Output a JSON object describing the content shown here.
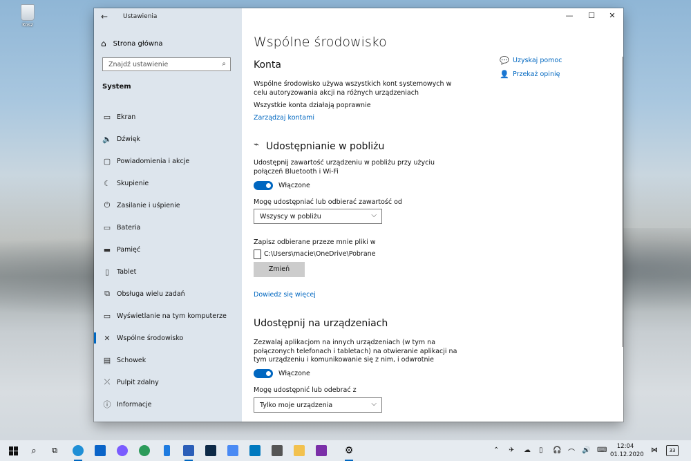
{
  "desktop": {
    "recycle_label": "Kosz"
  },
  "window": {
    "title": "Ustawienia",
    "back_icon": "arrow-left-icon",
    "controls": {
      "minimize": "—",
      "maximize": "☐",
      "close": "✕"
    }
  },
  "sidebar": {
    "home_label": "Strona główna",
    "search_placeholder": "Znajdź ustawienie",
    "section_title": "System",
    "items": [
      {
        "label": "Ekran",
        "icon": "monitor-icon",
        "glyph": "▭"
      },
      {
        "label": "Dźwięk",
        "icon": "speaker-icon",
        "glyph": "🔈"
      },
      {
        "label": "Powiadomienia i akcje",
        "icon": "notification-icon",
        "glyph": "▢"
      },
      {
        "label": "Skupienie",
        "icon": "moon-icon",
        "glyph": "☾"
      },
      {
        "label": "Zasilanie i uśpienie",
        "icon": "power-icon",
        "glyph": "⏻"
      },
      {
        "label": "Bateria",
        "icon": "battery-icon",
        "glyph": "▭"
      },
      {
        "label": "Pamięć",
        "icon": "storage-icon",
        "glyph": "▬"
      },
      {
        "label": "Tablet",
        "icon": "tablet-icon",
        "glyph": "▯"
      },
      {
        "label": "Obsługa wielu zadań",
        "icon": "multitasking-icon",
        "glyph": "⧉"
      },
      {
        "label": "Wyświetlanie na tym komputerze",
        "icon": "project-icon",
        "glyph": "▭"
      },
      {
        "label": "Wspólne środowisko",
        "icon": "shared-experiences-icon",
        "glyph": "✕"
      },
      {
        "label": "Schowek",
        "icon": "clipboard-icon",
        "glyph": "▤"
      },
      {
        "label": "Pulpit zdalny",
        "icon": "remote-desktop-icon",
        "glyph": "⤫"
      },
      {
        "label": "Informacje",
        "icon": "info-icon",
        "glyph": "ⓘ"
      }
    ]
  },
  "main": {
    "page_title": "Wspólne środowisko",
    "konta": {
      "heading": "Konta",
      "desc": "Wspólne środowisko używa wszystkich kont systemowych w celu autoryzowania akcji na różnych urządzeniach",
      "status": "Wszystkie konta działają poprawnie",
      "link": "Zarządzaj kontami"
    },
    "nearby": {
      "heading": "Udostępnianie w pobliżu",
      "desc": "Udostępnij zawartość urządzeniu w pobliżu przy użyciu połączeń Bluetooth i Wi-Fi",
      "toggle_label": "Włączone",
      "from_label": "Mogę udostępniać lub odbierać zawartość od",
      "from_value": "Wszyscy w pobliżu",
      "save_label": "Zapisz odbierane przeze mnie pliki w",
      "save_path": "C:\\Users\\macie\\OneDrive\\Pobrane",
      "change_button": "Zmień",
      "learn_more": "Dowiedz się więcej"
    },
    "devices": {
      "heading": "Udostępnij na urządzeniach",
      "desc": "Zezwalaj aplikacjom na innych urządzeniach (w tym na połączonych telefonach i tabletach) na otwieranie aplikacji na tym urządzeniu i komunikowanie się z nim, i odwrotnie",
      "toggle_label": "Włączone",
      "from_label": "Mogę udostępnić lub odebrać z",
      "from_value": "Tylko moje urządzenia"
    },
    "aside": {
      "help": "Uzyskaj pomoc",
      "feedback": "Przekaż opinię"
    }
  },
  "taskbar": {
    "time": "12:04",
    "date": "01.12.2020",
    "notifications": "33"
  }
}
